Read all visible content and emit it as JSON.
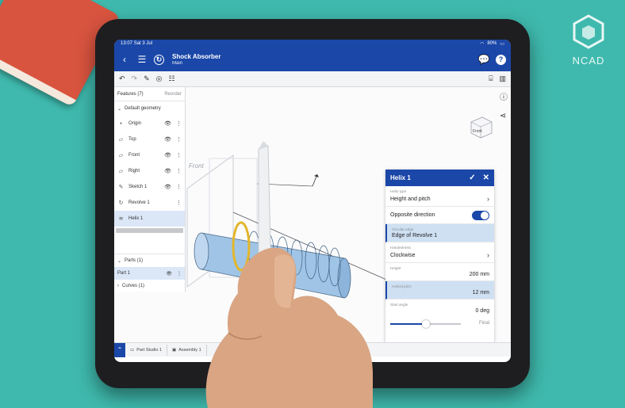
{
  "status": {
    "time": "13:07",
    "date": "Sat 3 Jul",
    "battery": "80%"
  },
  "document": {
    "title": "Shock Absorber",
    "workspace": "Main"
  },
  "features_panel": {
    "title": "Features (7)",
    "reorder_label": "Reorder",
    "default_group": "Default geometry",
    "items": [
      {
        "label": "Origin",
        "icon": "origin-dot-icon"
      },
      {
        "label": "Top",
        "icon": "plane-icon"
      },
      {
        "label": "Front",
        "icon": "plane-icon"
      },
      {
        "label": "Right",
        "icon": "plane-icon"
      },
      {
        "label": "Sketch 1",
        "icon": "sketch-icon"
      },
      {
        "label": "Revolve 1",
        "icon": "revolve-icon"
      },
      {
        "label": "Helix 1",
        "icon": "helix-icon",
        "selected": true
      }
    ]
  },
  "parts_panel": {
    "parts_label": "Parts (1)",
    "part_name": "Part 1",
    "curves_label": "Curves (1)"
  },
  "helix_dialog": {
    "title": "Helix 1",
    "helix_type_label": "Helix type",
    "helix_type_value": "Height and pitch",
    "opposite_direction_label": "Opposite direction",
    "opposite_direction_on": true,
    "circular_edge_label": "Circular edge",
    "circular_edge_value": "Edge of Revolve 1",
    "handedness_label": "Handedness",
    "handedness_value": "Clockwise",
    "height_label": "Height",
    "height_value": "200 mm",
    "pitch_label": "Helical pitch",
    "pitch_value": "12 mm",
    "start_angle_label": "Start angle",
    "start_angle_value": "0 deg",
    "final_label": "Final"
  },
  "viewport": {
    "plane_label": "Front",
    "viewcube_face": "Front"
  },
  "tabs": [
    {
      "label": "Part Studio 1"
    },
    {
      "label": "Assembly 1"
    }
  ],
  "watermark": {
    "text": "NCAD"
  },
  "colors": {
    "accent": "#1a47a8",
    "selection": "#dbe7f7",
    "background": "#3fb9ad",
    "helix_ring": "#e3b62b"
  }
}
